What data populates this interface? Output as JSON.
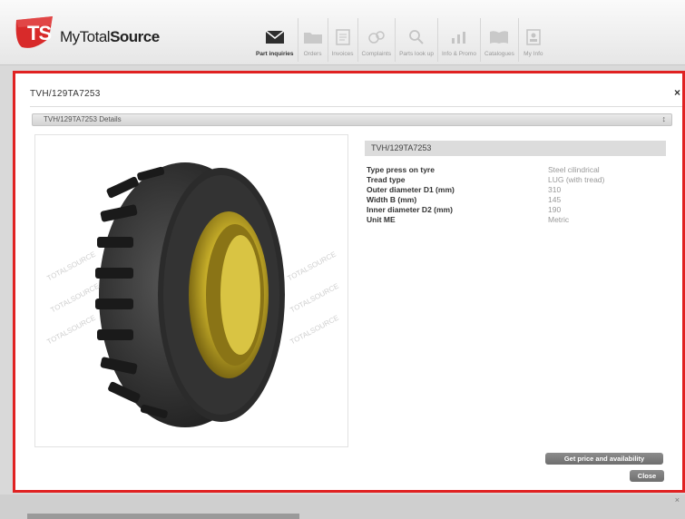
{
  "header": {
    "logo_letters": "TS",
    "logo_name_plain": "MyTotal",
    "logo_name_bold": "Source",
    "nav": [
      {
        "label": "Part inquiries",
        "icon": "envelope-icon",
        "active": true
      },
      {
        "label": "Orders",
        "icon": "folder-icon",
        "active": false
      },
      {
        "label": "Invoices",
        "icon": "document-icon",
        "active": false
      },
      {
        "label": "Complaints",
        "icon": "chat-bubbles-icon",
        "active": false
      },
      {
        "label": "Parts look up",
        "icon": "magnifier-icon",
        "active": false
      },
      {
        "label": "Info & Promo",
        "icon": "bar-chart-icon",
        "active": false
      },
      {
        "label": "Catalogues",
        "icon": "book-icon",
        "active": false
      },
      {
        "label": "My Info",
        "icon": "profile-card-icon",
        "active": false
      }
    ]
  },
  "modal": {
    "title": "TVH/129TA7253",
    "close_glyph": "×",
    "details_label": "TVH/129TA7253 Details",
    "details_toggle": "↕",
    "product_header": "TVH/129TA7253",
    "watermark": "TOTALSOURCE",
    "specs": [
      {
        "key": "Type press on tyre",
        "value": "Steel cilindrical"
      },
      {
        "key": "Tread type",
        "value": "LUG (with tread)"
      },
      {
        "key": "Outer diameter D1 (mm)",
        "value": "310"
      },
      {
        "key": "Width B (mm)",
        "value": "145"
      },
      {
        "key": "Inner diameter D2 (mm)",
        "value": "190"
      },
      {
        "key": "Unit ME",
        "value": "Metric"
      }
    ],
    "price_button": "Get price and availability",
    "close_button": "Close"
  },
  "bottom_close_glyph": "×",
  "colors": {
    "highlight_border": "#e02222",
    "logo_red": "#d82a2a",
    "button": "#7a7a7a"
  }
}
